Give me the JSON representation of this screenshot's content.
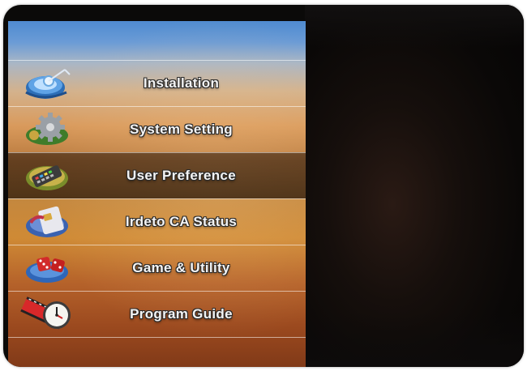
{
  "menu": {
    "items": [
      {
        "label": "Installation",
        "icon": "satellite-dish-icon",
        "selected": false
      },
      {
        "label": "System Setting",
        "icon": "gear-icon",
        "selected": false
      },
      {
        "label": "User Preference",
        "icon": "remote-control-icon",
        "selected": true
      },
      {
        "label": "Irdeto CA Status",
        "icon": "smart-card-icon",
        "selected": false
      },
      {
        "label": "Game & Utility",
        "icon": "dice-icon",
        "selected": false
      },
      {
        "label": "Program Guide",
        "icon": "clock-film-icon",
        "selected": false
      }
    ]
  },
  "colors": {
    "panel_top": "#4f8bd0",
    "panel_bottom": "#7e3817",
    "label_text": "#f4f4f4",
    "selected_bg": "#2b170a"
  }
}
